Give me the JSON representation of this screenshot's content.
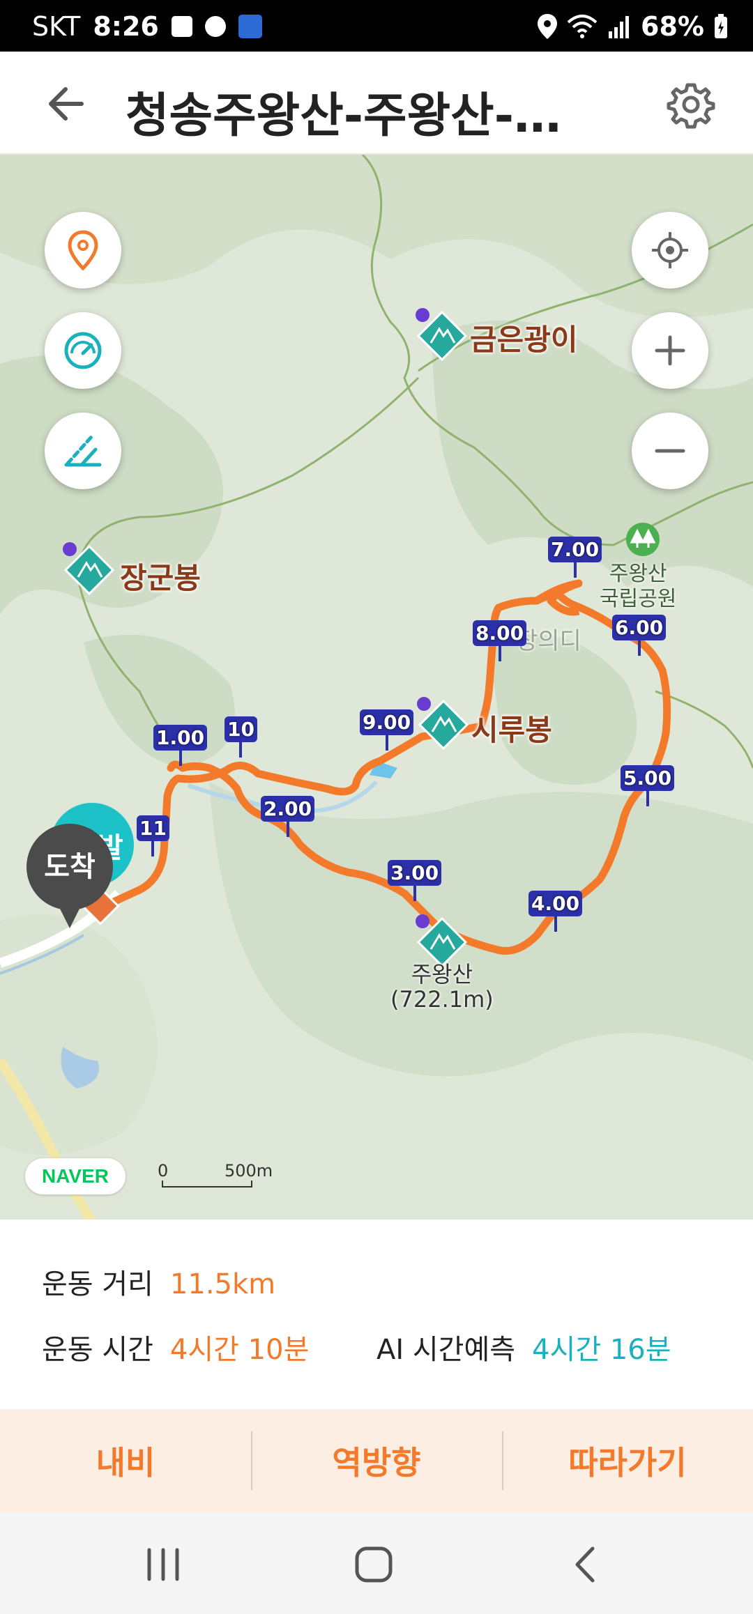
{
  "status_bar": {
    "carrier": "SKT",
    "time": "8:26",
    "battery": "68%"
  },
  "header": {
    "title": "청송주왕산-주왕산-…"
  },
  "map": {
    "peaks": {
      "geumeun": "금은광이",
      "janggun": "장군봉",
      "siru": "시루봉",
      "juwang": "주왕산",
      "juwang_elev": "(722.1m)"
    },
    "park_label_1": "주왕산",
    "park_label_2": "국립공원",
    "faded_label": "장의디",
    "markers": [
      "1.00",
      "2.00",
      "3.00",
      "4.00",
      "5.00",
      "6.00",
      "7.00",
      "8.00",
      "9.00",
      "10",
      "11"
    ],
    "arrive_label": "도착",
    "start_partial": "발",
    "naver_logo": "NAVER",
    "scale_zero": "0",
    "scale_dist": "500m",
    "route_color": "#f47a2b",
    "marker_color": "#2b2fa8"
  },
  "info": {
    "distance_label": "운동 거리",
    "distance_value": "11.5km",
    "time_label": "운동 시간",
    "time_value": "4시간 10분",
    "ai_label": "AI 시간예측",
    "ai_value": "4시간 16분"
  },
  "actions": {
    "navi": "내비",
    "reverse": "역방향",
    "follow": "따라가기"
  }
}
